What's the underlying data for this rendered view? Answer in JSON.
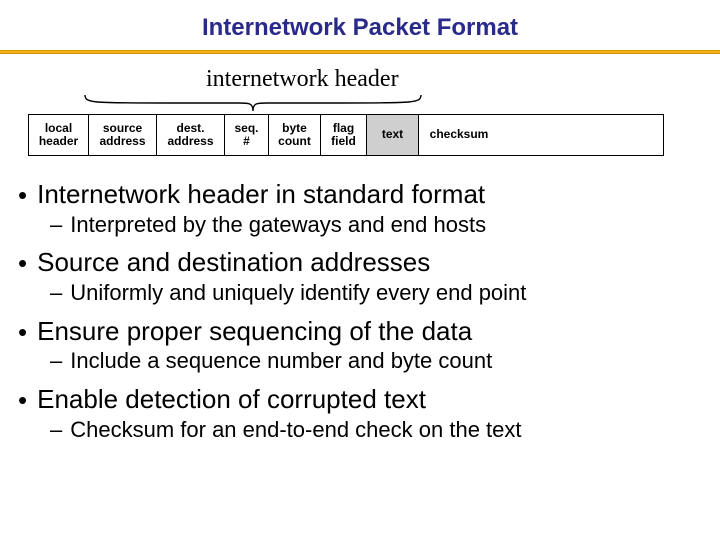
{
  "title": "Internetwork Packet Format",
  "bracket_label": "internetwork header",
  "packet": {
    "local": {
      "l1": "local",
      "l2": "header"
    },
    "source": {
      "l1": "source",
      "l2": "address"
    },
    "dest": {
      "l1": "dest.",
      "l2": "address"
    },
    "seq": {
      "l1": "seq.",
      "l2": "#"
    },
    "byte": {
      "l1": "byte",
      "l2": "count"
    },
    "flag": {
      "l1": "flag",
      "l2": "field"
    },
    "text": {
      "l1": "text"
    },
    "cksum": {
      "l1": "checksum"
    }
  },
  "bullets": [
    {
      "main": "Internetwork header in standard format",
      "sub": "Interpreted by the gateways and end hosts"
    },
    {
      "main": "Source and destination addresses",
      "sub": "Uniformly and uniquely identify every end point"
    },
    {
      "main": "Ensure proper sequencing of the data",
      "sub": "Include a sequence number and byte count"
    },
    {
      "main": "Enable detection of corrupted text",
      "sub": "Checksum for an end-to-end check on the text"
    }
  ]
}
